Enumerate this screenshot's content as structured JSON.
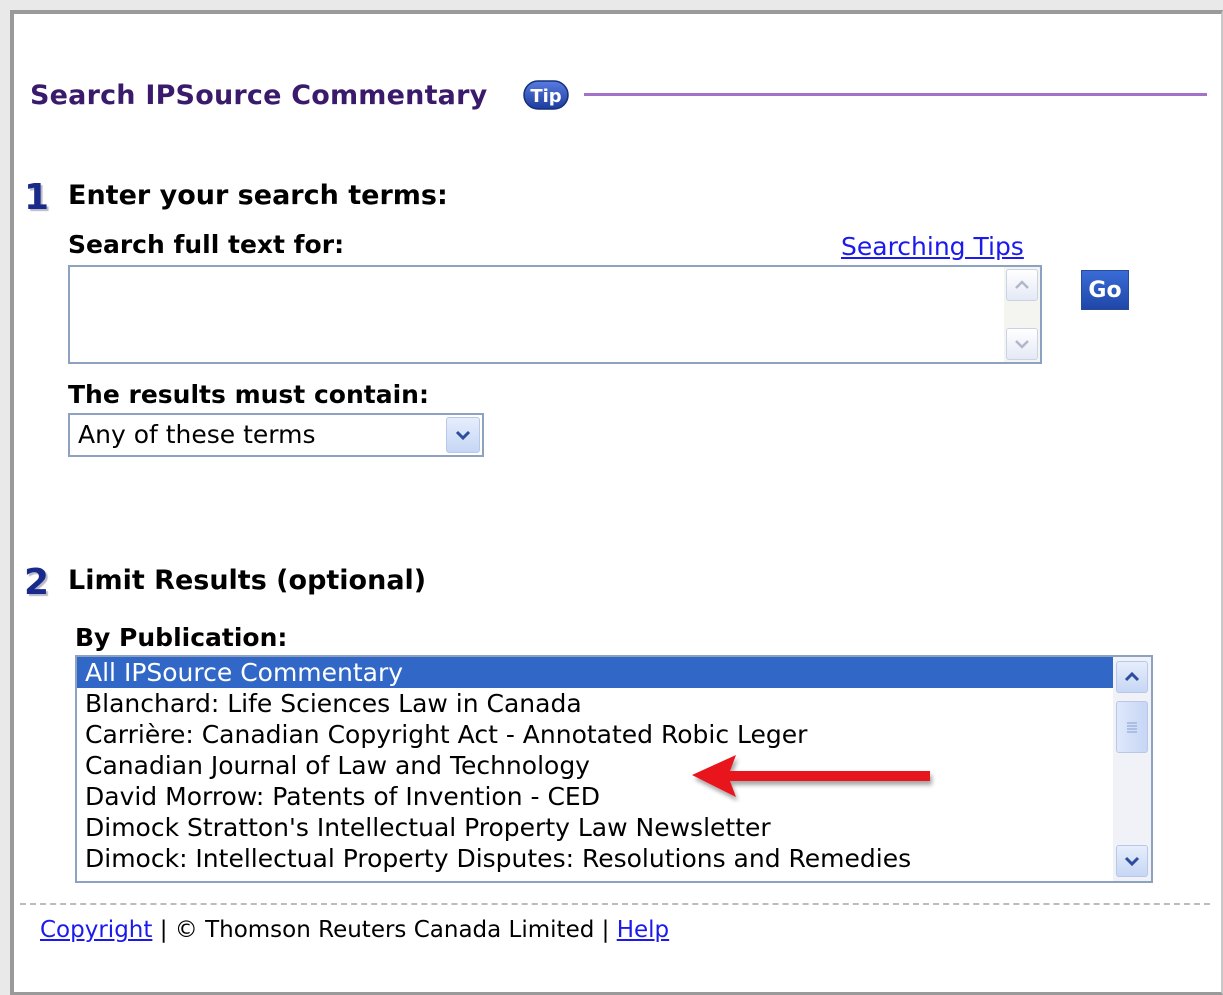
{
  "header": {
    "title": "Search IPSource Commentary",
    "tip_icon_label": "Tip"
  },
  "step1": {
    "number": "1",
    "label": "Enter your search terms:",
    "search_label": "Search full text for:",
    "tips_link": "Searching Tips",
    "search_value": "",
    "go_label": "Go",
    "must_contain_label": "The results must contain:",
    "must_contain_selected": "Any of these terms"
  },
  "step2": {
    "number": "2",
    "label": "Limit Results (optional)",
    "by_publication_label": "By Publication:",
    "publications": [
      "All IPSource Commentary",
      "Blanchard: Life Sciences Law in Canada",
      "Carrière: Canadian Copyright Act - Annotated Robic Leger",
      "Canadian Journal of Law and Technology",
      "David Morrow: Patents of Invention - CED",
      "Dimock Stratton's Intellectual Property Law Newsletter",
      "Dimock: Intellectual Property Disputes: Resolutions and Remedies"
    ],
    "selected_index": 0
  },
  "footer": {
    "copyright_link": "Copyright",
    "separator1": " | ",
    "company": "© Thomson Reuters Canada Limited",
    "separator2": " | ",
    "help_link": "Help"
  },
  "colors": {
    "title": "#3a1a6b",
    "header_rule": "#a272c8",
    "step_number": "#1a2a8a",
    "link": "#1a1aee",
    "selection": "#3168c8",
    "go_button": "#1f47a8",
    "annotation_arrow": "#e8141a"
  },
  "icons": {
    "tip": "tip-badge-icon",
    "scroll_up": "chevron-up-icon",
    "scroll_down": "chevron-down-icon",
    "annotation": "red-arrow-icon"
  }
}
